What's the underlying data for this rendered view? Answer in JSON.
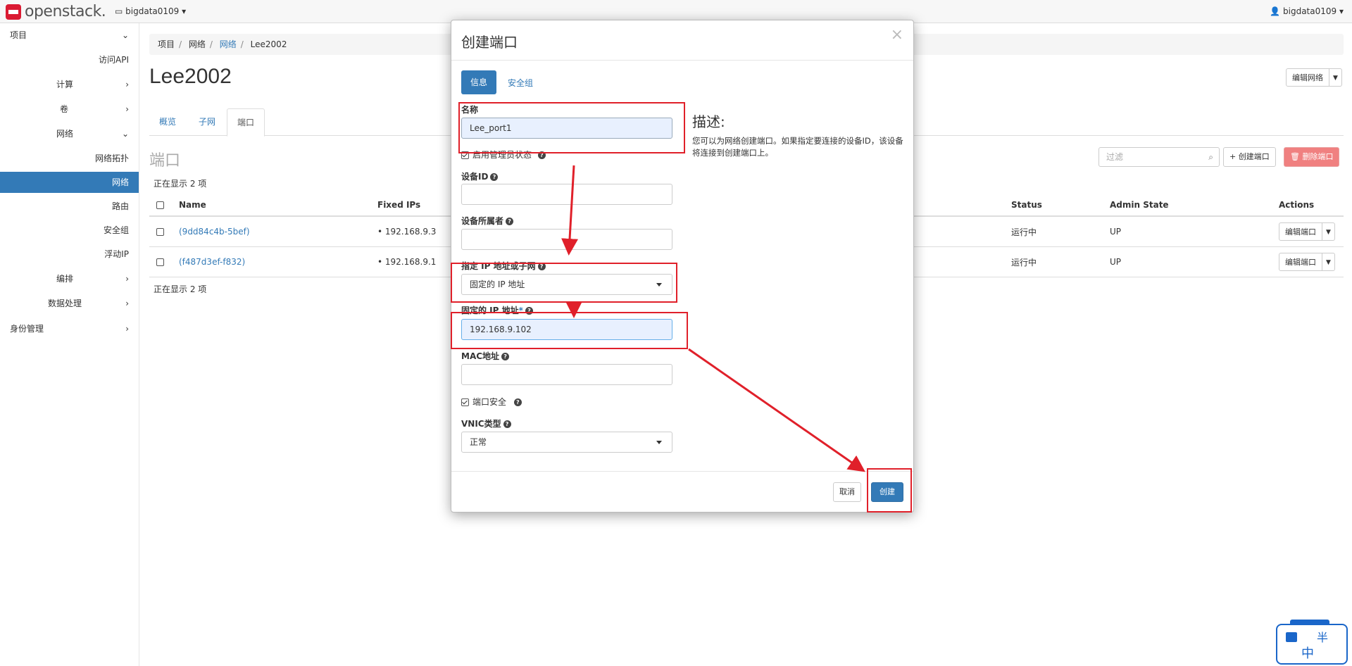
{
  "topbar": {
    "logo_text": "openstack.",
    "project_selector": "bigdata0109",
    "user_menu": "bigdata0109"
  },
  "sidebar": {
    "items": [
      {
        "label": "项目",
        "arrow": "⌄"
      },
      {
        "label": "访问API",
        "arrow": ""
      },
      {
        "label": "计算",
        "arrow": "›"
      },
      {
        "label": "卷",
        "arrow": "›"
      },
      {
        "label": "网络",
        "arrow": "⌄"
      },
      {
        "label": "网络拓扑",
        "arrow": ""
      },
      {
        "label": "网络",
        "arrow": ""
      },
      {
        "label": "路由",
        "arrow": ""
      },
      {
        "label": "安全组",
        "arrow": ""
      },
      {
        "label": "浮动IP",
        "arrow": ""
      },
      {
        "label": "编排",
        "arrow": "›"
      },
      {
        "label": "数据处理",
        "arrow": "›"
      },
      {
        "label": "身份管理",
        "arrow": "›"
      }
    ]
  },
  "breadcrumb": {
    "items": [
      "项目",
      "网络",
      "网络",
      "Lee2002"
    ],
    "sep": "/"
  },
  "page": {
    "title": "Lee2002",
    "edit_network_label": "编辑网络",
    "tabs": [
      "概览",
      "子网",
      "端口"
    ],
    "section_title": "端口",
    "filter_placeholder": "过滤",
    "create_port_label": "+ 创建端口",
    "delete_port_label": "🗑 删除端口",
    "count_text": "正在显示 2 项"
  },
  "ports_table": {
    "headers": [
      "Name",
      "Fixed IPs",
      "Status",
      "Admin State",
      "Actions"
    ],
    "rows": [
      {
        "name": "(9dd84c4b-5bef)",
        "fixed_ip": "192.168.9.3",
        "status": "运行中",
        "admin_state": "UP",
        "action": "编辑端口"
      },
      {
        "name": "(f487d3ef-f832)",
        "fixed_ip": "192.168.9.1",
        "status": "运行中",
        "admin_state": "UP",
        "action": "编辑端口"
      }
    ]
  },
  "modal": {
    "title": "创建端口",
    "close": "×",
    "tab_info": "信息",
    "tab_security": "安全组",
    "name_label": "名称",
    "name_value": "Lee_port1",
    "admin_state_label": "启用管理员状态",
    "device_id_label": "设备ID",
    "device_owner_label": "设备所属者",
    "ip_or_subnet_label": "指定 IP 地址或子网",
    "ip_or_subnet_value": "固定的 IP 地址",
    "fixed_ip_label": "固定的 IP 地址",
    "required_mark": "*",
    "fixed_ip_value": "192.168.9.102",
    "mac_label": "MAC地址",
    "port_security_label": "端口安全",
    "vnic_label": "VNIC类型",
    "vnic_value": "正常",
    "desc_title": "描述:",
    "desc_text": "您可以为网络创建端口。如果指定要连接的设备ID，该设备将连接到创建端口上。",
    "cancel_label": "取消",
    "create_label": "创建"
  },
  "ime": {
    "chars": [
      "半",
      "中"
    ]
  },
  "colors": {
    "primary": "#337ab7",
    "annotation": "#e0202a",
    "danger_disabled": "#f08080"
  }
}
